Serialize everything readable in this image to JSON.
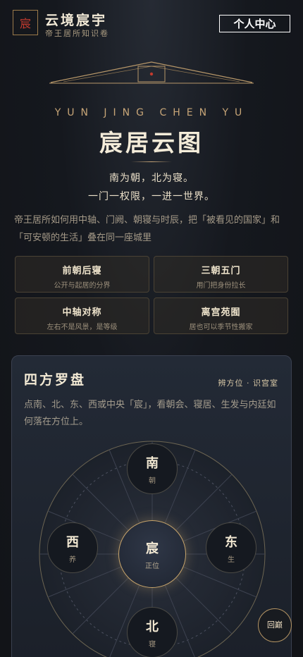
{
  "header": {
    "seal_char": "宸",
    "brand_title": "云境宸宇",
    "brand_sub": "帝王居所知识卷",
    "profile_button": "个人中心"
  },
  "hero": {
    "eyebrow": "YUN JING CHEN YU",
    "title": "宸居云图",
    "motto_line1": "南为朝，北为寝。",
    "motto_line2": "一门一权限，一进一世界。",
    "intro": "帝王居所如何用中轴、门阙、朝寝与时辰，把「被看见的国家」和「可安顿的生活」叠在同一座城里"
  },
  "tags": [
    {
      "title": "前朝后寝",
      "sub": "公开与起居的分界"
    },
    {
      "title": "三朝五门",
      "sub": "用门把身份拉长"
    },
    {
      "title": "中轴对称",
      "sub": "左右不是风景，是等级"
    },
    {
      "title": "离宫苑囿",
      "sub": "居也可以季节性搬家"
    }
  ],
  "compass_panel": {
    "title": "四方罗盘",
    "links": "辨方位 · 识宫室",
    "description": "点南、北、东、西或中央「宸」，看朝会、寝居、生发与内廷如何落在方位上。",
    "directions": {
      "south": {
        "name": "南",
        "sub": "朝"
      },
      "west": {
        "name": "西",
        "sub": "养"
      },
      "center": {
        "name": "宸",
        "sub": "正位"
      },
      "east": {
        "name": "东",
        "sub": "生"
      },
      "north": {
        "name": "北",
        "sub": "寝"
      }
    }
  },
  "back_to_top": "回巅",
  "colors": {
    "accent_gold": "#c7a577",
    "seal_red": "#c13a2e",
    "background": "#15181e"
  }
}
